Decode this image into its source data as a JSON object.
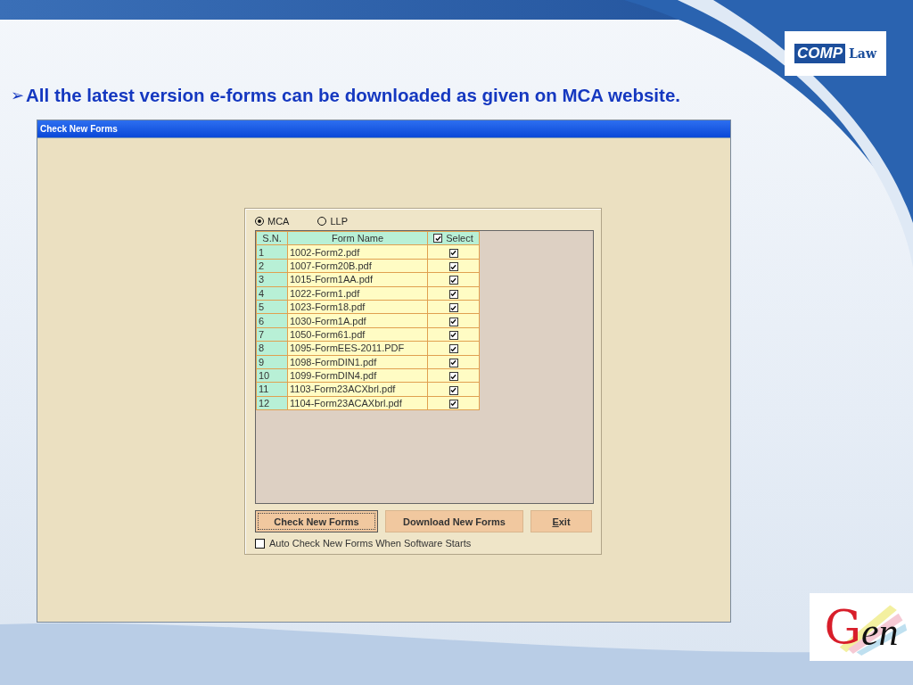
{
  "slide": {
    "bullet": "➢",
    "heading": "All the latest version e-forms can be downloaded as given on MCA website."
  },
  "logo_top": {
    "part_1": "COMP",
    "part_2": "Law"
  },
  "logo_bottom": {
    "initial": "G",
    "rest": "en"
  },
  "window": {
    "title": "Check New Forms"
  },
  "sources": [
    {
      "label": "MCA",
      "selected": true
    },
    {
      "label": "LLP",
      "selected": false
    }
  ],
  "table": {
    "columns": [
      {
        "label": "S.N.",
        "kind": "text"
      },
      {
        "label": "Form Name",
        "kind": "text"
      },
      {
        "label": "Select",
        "kind": "check",
        "checked": true
      }
    ],
    "rows": [
      {
        "sn": "1",
        "name": "1002-Form2.pdf",
        "checked": true
      },
      {
        "sn": "2",
        "name": "1007-Form20B.pdf",
        "checked": true
      },
      {
        "sn": "3",
        "name": "1015-Form1AA.pdf",
        "checked": true
      },
      {
        "sn": "4",
        "name": "1022-Form1.pdf",
        "checked": true
      },
      {
        "sn": "5",
        "name": "1023-Form18.pdf",
        "checked": true
      },
      {
        "sn": "6",
        "name": "1030-Form1A.pdf",
        "checked": true
      },
      {
        "sn": "7",
        "name": "1050-Form61.pdf",
        "checked": true
      },
      {
        "sn": "8",
        "name": "1095-FormEES-2011.PDF",
        "checked": true
      },
      {
        "sn": "9",
        "name": "1098-FormDIN1.pdf",
        "checked": true
      },
      {
        "sn": "10",
        "name": "1099-FormDIN4.pdf",
        "checked": true
      },
      {
        "sn": "11",
        "name": "1103-Form23ACXbrl.pdf",
        "checked": true
      },
      {
        "sn": "12",
        "name": "1104-Form23ACAXbrl.pdf",
        "checked": true
      }
    ]
  },
  "buttons": [
    {
      "label": "Check New Forms",
      "focused": true,
      "mnemonic": false
    },
    {
      "label": "Download New Forms",
      "focused": false,
      "mnemonic": false
    },
    {
      "label": "Exit",
      "focused": false,
      "mnemonic": true
    }
  ],
  "auto_check": {
    "label": "Auto Check New Forms When Software Starts",
    "checked": false
  }
}
